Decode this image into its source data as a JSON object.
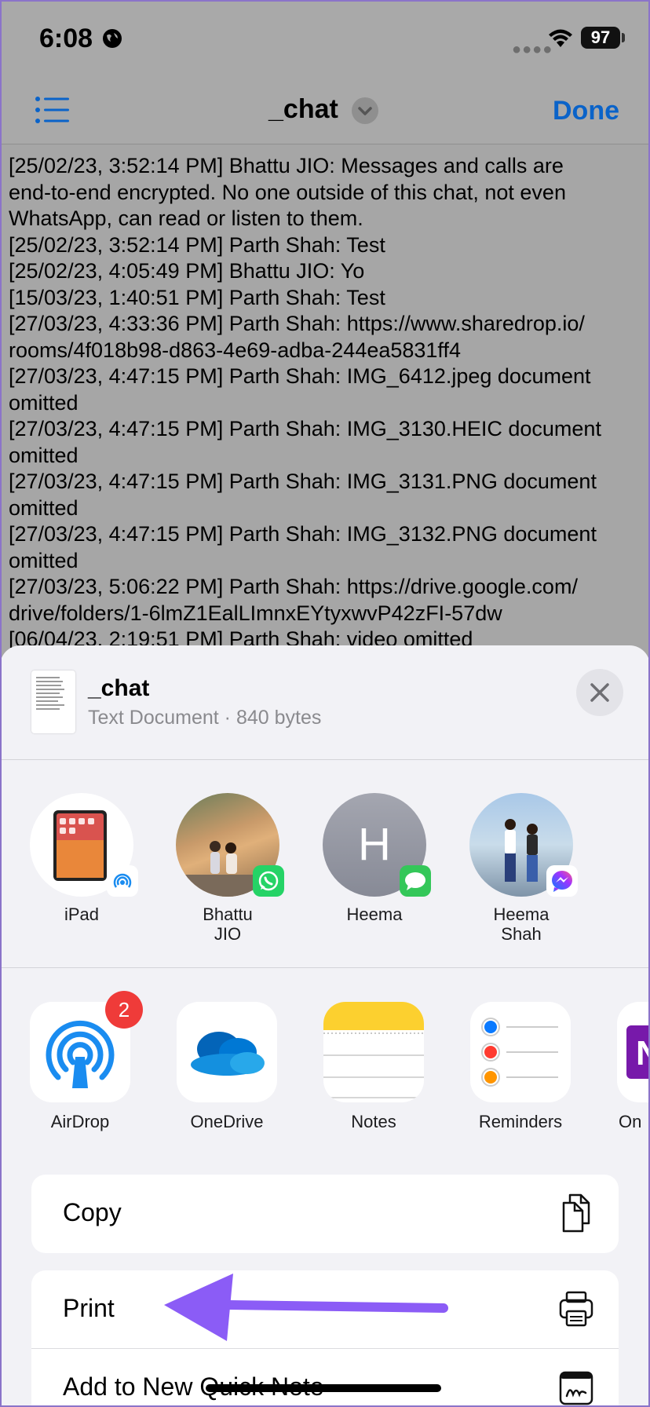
{
  "status_bar": {
    "time": "6:08",
    "battery": "97"
  },
  "nav": {
    "title": "_chat",
    "done_label": "Done"
  },
  "chat_lines": [
    "[25/02/23, 3:52:14 PM] Bhattu JIO: Messages and calls are",
    "end-to-end encrypted. No one outside of this chat, not even",
    "WhatsApp, can read or listen to them.",
    "[25/02/23, 3:52:14 PM] Parth Shah: Test",
    "[25/02/23, 4:05:49 PM] Bhattu JIO: Yo",
    "[15/03/23, 1:40:51 PM] Parth Shah: Test",
    "[27/03/23, 4:33:36 PM] Parth Shah: https://www.sharedrop.io/",
    "rooms/4f018b98-d863-4e69-adba-244ea5831ff4",
    "[27/03/23, 4:47:15 PM] Parth Shah: IMG_6412.jpeg document",
    "omitted",
    "[27/03/23, 4:47:15 PM] Parth Shah: IMG_3130.HEIC document",
    "omitted",
    "[27/03/23, 4:47:15 PM] Parth Shah: IMG_3131.PNG document",
    "omitted",
    "[27/03/23, 4:47:15 PM] Parth Shah: IMG_3132.PNG document",
    "omitted",
    "[27/03/23, 5:06:22 PM] Parth Shah: https://drive.google.com/",
    "drive/folders/1-6lmZ1EalLImnxEYtyxwvP42zFI-57dw",
    "[06/04/23, 2:19:51 PM] Parth Shah: video omitted"
  ],
  "share_sheet": {
    "doc_title": "_chat",
    "doc_subtitle": "Text Document · 840 bytes",
    "people": [
      {
        "label": "iPad",
        "badge": "airdrop-icon"
      },
      {
        "label": "Bhattu\nJIO",
        "badge": "whatsapp-icon"
      },
      {
        "label": "Heema",
        "initial": "H",
        "badge": "messages-icon"
      },
      {
        "label": "Heema\nShah",
        "badge": "messenger-icon"
      }
    ],
    "apps": [
      {
        "label": "AirDrop",
        "badge": "2"
      },
      {
        "label": "OneDrive"
      },
      {
        "label": "Notes"
      },
      {
        "label": "Reminders"
      },
      {
        "label": "On"
      }
    ],
    "actions": [
      {
        "label": "Copy",
        "icon": "copy-icon"
      },
      {
        "label": "Print",
        "icon": "printer-icon"
      },
      {
        "label": "Add to New Quick Note",
        "icon": "quick-note-icon"
      }
    ]
  },
  "colors": {
    "accent": "#0a63c9",
    "arrow": "#8b5cf6",
    "badge_red": "#ef3b39",
    "whatsapp": "#25d366",
    "messages": "#34c759"
  }
}
